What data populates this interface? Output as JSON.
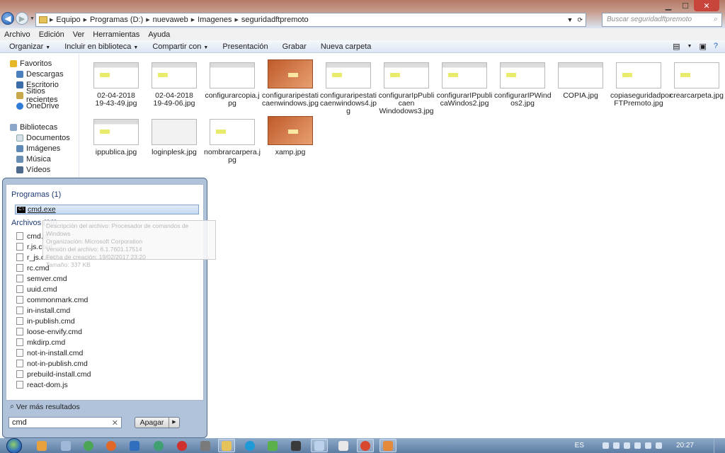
{
  "window": {
    "title_controls": [
      "minimize",
      "maximize",
      "close"
    ],
    "breadcrumbs": [
      "Equipo",
      "Programas (D:)",
      "nuevaweb",
      "Imagenes",
      "seguridadftpremoto"
    ],
    "search_placeholder": "Buscar seguridadftpremoto"
  },
  "menubar": [
    "Archivo",
    "Edición",
    "Ver",
    "Herramientas",
    "Ayuda"
  ],
  "commandbar": {
    "organize": "Organizar",
    "include": "Incluir en biblioteca",
    "share": "Compartir con",
    "present": "Presentación",
    "burn": "Grabar",
    "new_folder": "Nueva carpeta"
  },
  "navpane": {
    "favorites_header": "Favoritos",
    "favorites": [
      "Descargas",
      "Escritorio",
      "Sitios recientes",
      "OneDrive"
    ],
    "libraries_header": "Bibliotecas",
    "libraries": [
      "Documentos",
      "Imágenes",
      "Música",
      "Vídeos"
    ]
  },
  "files": [
    {
      "name": "02-04-2018 19-43-49.jpg",
      "line1": "02-04-2018",
      "line2": "19-43-49.jpg",
      "line3": "",
      "thumb": "screen"
    },
    {
      "name": "02-04-2018 19-49-06.jpg",
      "line1": "02-04-2018",
      "line2": "19-49-06.jpg",
      "line3": "",
      "thumb": "screen"
    },
    {
      "name": "configurarcopia.jpg",
      "line1": "configurarcopia.j",
      "line2": "pg",
      "line3": "",
      "thumb": "plain"
    },
    {
      "name": "configuraripestaticaenwindows.jpg",
      "line1": "configuraripestati",
      "line2": "caenwindows.jpg",
      "line3": "",
      "thumb": "orange"
    },
    {
      "name": "configuraripestaticaenwindows4.jpg",
      "line1": "configuraripestati",
      "line2": "caenwindows4.jp",
      "line3": "g",
      "thumb": "screen"
    },
    {
      "name": "configurarIpPublicaenWindodows3.jpg",
      "line1": "configurarIpPubli",
      "line2": "caen",
      "line3": "Windodows3.jpg",
      "thumb": "screen"
    },
    {
      "name": "configurarIPpublicaWindos2.jpg",
      "line1": "configurarIPpubli",
      "line2": "caWindos2.jpg",
      "line3": "",
      "thumb": "screen"
    },
    {
      "name": "configurarIPWindos2.jpg",
      "line1": "configurarIPWind",
      "line2": "os2.jpg",
      "line3": "",
      "thumb": "screen"
    },
    {
      "name": "COPIA.jpg",
      "line1": "COPIA.jpg",
      "line2": "",
      "line3": "",
      "thumb": "plain"
    },
    {
      "name": "copiaseguridadporFTPremoto.jpg",
      "line1": "copiaseguridadpor",
      "line2": "FTPremoto.jpg",
      "line3": "",
      "thumb": "page"
    },
    {
      "name": "crearcarpeta.jpg",
      "line1": "crearcarpeta.jpg",
      "line2": "",
      "line3": "",
      "thumb": "page"
    },
    {
      "name": "ippublica.jpg",
      "line1": "ippublica.jpg",
      "line2": "",
      "line3": "",
      "thumb": "screen"
    },
    {
      "name": "loginplesk.jpg",
      "line1": "loginplesk.jpg",
      "line2": "",
      "line3": "",
      "thumb": "plain"
    },
    {
      "name": "nombrarcarpera.jpg",
      "line1": "nombrarcarpera.j",
      "line2": "pg",
      "line3": "",
      "thumb": "page"
    },
    {
      "name": "xamp.jpg",
      "line1": "xamp.jpg",
      "line2": "",
      "line3": "",
      "thumb": "orange"
    }
  ],
  "startmenu": {
    "programs_header": "Programas (1)",
    "program_selected": "cmd.exe",
    "files_header": "Archivos (28)",
    "file_items": [
      "cmd.js",
      "r.js.cmd",
      "r_js.cmd",
      "rc.cmd",
      "semver.cmd",
      "uuid.cmd",
      "commonmark.cmd",
      "in-install.cmd",
      "in-publish.cmd",
      "loose-envify.cmd",
      "mkdirp.cmd",
      "not-in-install.cmd",
      "not-in-publish.cmd",
      "prebuild-install.cmd",
      "react-dom.js"
    ],
    "more_results": "Ver más resultados",
    "search_value": "cmd",
    "shutdown_label": "Apagar",
    "tooltip_lines": [
      "Descripción del archivo: Procesador de comandos de Windows",
      "Organización: Microsoft Corporation",
      "Versión del archivo: 6.1.7601.17514",
      "Fecha de creación: 19/02/2017 23:20",
      "Tamaño: 337 KB"
    ]
  },
  "taskbar": {
    "language": "ES",
    "clock": "20:27"
  }
}
